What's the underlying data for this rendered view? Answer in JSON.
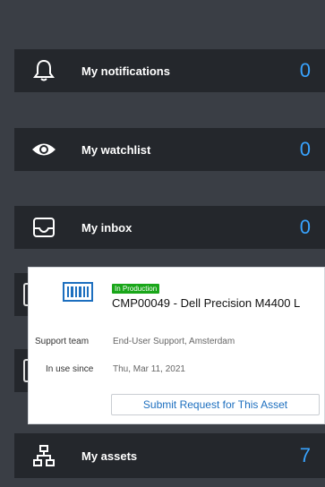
{
  "cards": {
    "notifications": {
      "label": "My notifications",
      "count": "0",
      "icon": "bell-icon"
    },
    "watchlist": {
      "label": "My watchlist",
      "count": "0",
      "icon": "eye-icon"
    },
    "inbox": {
      "label": "My inbox",
      "count": "0",
      "icon": "inbox-icon"
    },
    "assets": {
      "label": "My assets",
      "count": "7",
      "icon": "sitemap-icon"
    }
  },
  "asset_popup": {
    "status_badge": "In Production",
    "title": "CMP00049 - Dell Precision M4400 L",
    "support_team_label": "Support team",
    "support_team_value": "End-User Support, Amsterdam",
    "in_use_since_label": "In use since",
    "in_use_since_value": "Thu, Mar 11, 2021",
    "submit_button": "Submit Request for This Asset"
  },
  "colors": {
    "background": "#3a3e45",
    "card": "#24272c",
    "count_accent": "#38a3ff",
    "badge_green": "#19a619",
    "button_text": "#1d6fbf"
  }
}
